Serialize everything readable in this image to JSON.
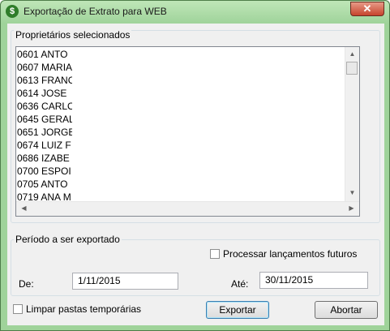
{
  "window": {
    "title": "Exportação de Extrato para WEB",
    "close_label": "✕",
    "icon_glyph": "$",
    "accent_color": "#9fd39a"
  },
  "owners": {
    "group_label": "Proprietários selecionados",
    "items": [
      "0601 ANTO",
      "0607 MARIA",
      "0613 FRANC",
      "0614 JOSE",
      "0636 CARLO",
      "0645 GERAL",
      "0651 JORGE",
      "0674 LUIZ F",
      "0686 IZABE",
      "0700 ESPOI",
      "0705 ANTO",
      "0719 ANA M"
    ]
  },
  "period": {
    "group_label": "Período a ser exportado",
    "future_checkbox_label": "Processar lançamentos futuros",
    "future_checked": false,
    "from_label": "De:",
    "from_value": "1/11/2015",
    "to_label": "Até:",
    "to_value": "30/11/2015"
  },
  "footer": {
    "clear_temp_label": "Limpar pastas temporárias",
    "clear_temp_checked": false,
    "export_label": "Exportar",
    "abort_label": "Abortar"
  }
}
